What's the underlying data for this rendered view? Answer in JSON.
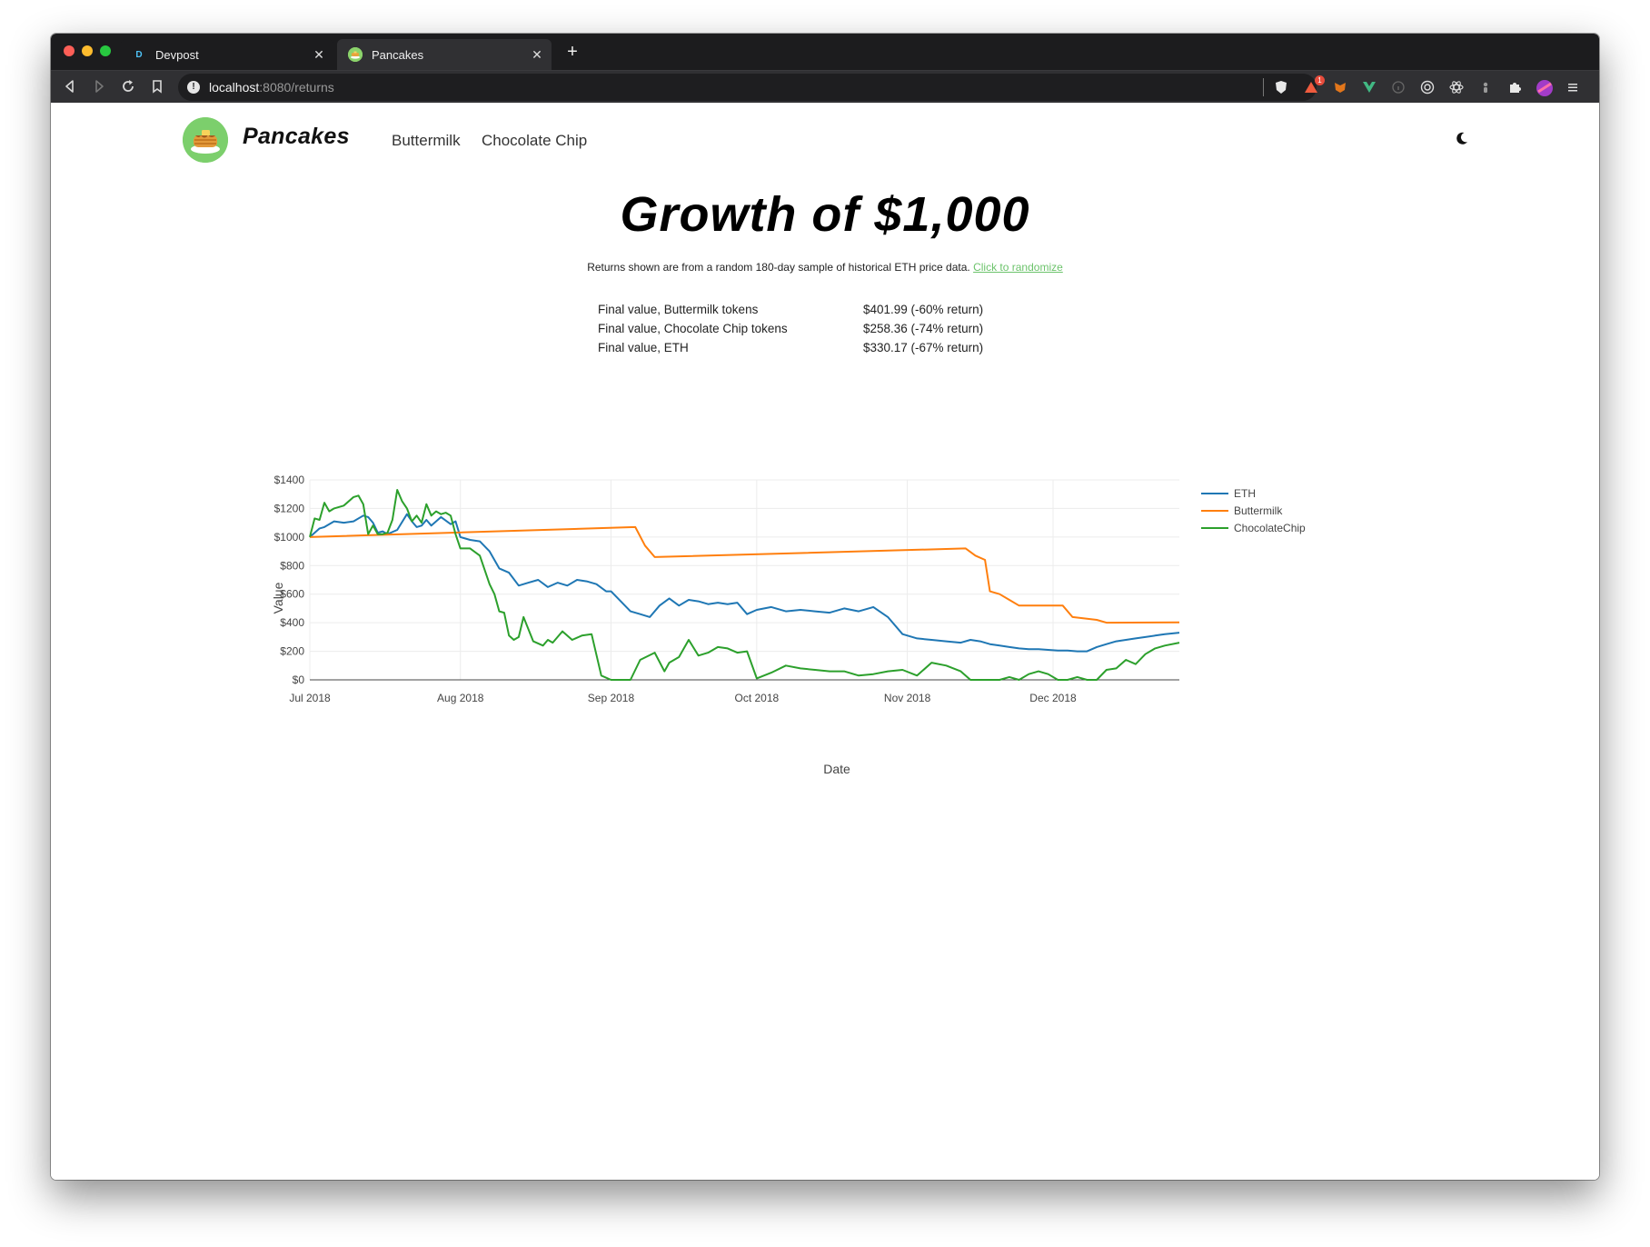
{
  "browser": {
    "tabs": [
      {
        "title": "Devpost",
        "favicon": "D",
        "active": false
      },
      {
        "title": "Pancakes",
        "favicon": "",
        "active": true
      }
    ],
    "url": {
      "host": "localhost",
      "path": ":8080/returns"
    },
    "close_symbol": "✕",
    "new_tab_symbol": "+",
    "extension_badge": "1"
  },
  "nav": {
    "brand": "Pancakes",
    "links": [
      "Buttermilk",
      "Chocolate Chip"
    ]
  },
  "page": {
    "heading": "Growth of $1,000",
    "subtitle": "Returns shown are from a random 180-day sample of historical ETH price data.",
    "randomize_link": "Click to randomize"
  },
  "results": [
    {
      "label": "Final value, Buttermilk tokens",
      "value": "$401.99 (-60% return)"
    },
    {
      "label": "Final value, Chocolate Chip tokens",
      "value": "$258.36 (-74% return)"
    },
    {
      "label": "Final value, ETH",
      "value": "$330.17 (-67% return)"
    }
  ],
  "colors": {
    "eth": "#1f77b4",
    "buttermilk": "#ff7f0e",
    "chocolatechip": "#2ca02c",
    "link": "#6cc36b"
  },
  "chart_data": {
    "type": "line",
    "xlabel": "Date",
    "ylabel": "Value",
    "x_range": [
      "2018-07-01",
      "2018-12-27"
    ],
    "ylim": [
      0,
      1400
    ],
    "y_ticks": [
      0,
      200,
      400,
      600,
      800,
      1000,
      1200,
      1400
    ],
    "y_tick_labels": [
      "$0",
      "$200",
      "$400",
      "$600",
      "$800",
      "$1000",
      "$1200",
      "$1400"
    ],
    "x_ticks": [
      "2018-07-01",
      "2018-08-01",
      "2018-09-01",
      "2018-10-01",
      "2018-11-01",
      "2018-12-01"
    ],
    "x_tick_labels": [
      "Jul 2018",
      "Aug 2018",
      "Sep 2018",
      "Oct 2018",
      "Nov 2018",
      "Dec 2018"
    ],
    "grid": true,
    "legend": "top-right",
    "series": [
      {
        "name": "ETH",
        "x": [
          "2018-07-01",
          "2018-07-03",
          "2018-07-04",
          "2018-07-06",
          "2018-07-08",
          "2018-07-10",
          "2018-07-12",
          "2018-07-13",
          "2018-07-14",
          "2018-07-15",
          "2018-07-16",
          "2018-07-17",
          "2018-07-19",
          "2018-07-21",
          "2018-07-22",
          "2018-07-23",
          "2018-07-24",
          "2018-07-25",
          "2018-07-26",
          "2018-07-28",
          "2018-07-30",
          "2018-07-31",
          "2018-08-01",
          "2018-08-03",
          "2018-08-05",
          "2018-08-07",
          "2018-08-09",
          "2018-08-11",
          "2018-08-13",
          "2018-08-15",
          "2018-08-17",
          "2018-08-19",
          "2018-08-21",
          "2018-08-23",
          "2018-08-25",
          "2018-08-27",
          "2018-08-29",
          "2018-08-31",
          "2018-09-01",
          "2018-09-03",
          "2018-09-05",
          "2018-09-07",
          "2018-09-09",
          "2018-09-11",
          "2018-09-13",
          "2018-09-15",
          "2018-09-17",
          "2018-09-19",
          "2018-09-21",
          "2018-09-23",
          "2018-09-25",
          "2018-09-27",
          "2018-09-29",
          "2018-10-01",
          "2018-10-04",
          "2018-10-07",
          "2018-10-10",
          "2018-10-13",
          "2018-10-16",
          "2018-10-19",
          "2018-10-22",
          "2018-10-25",
          "2018-10-28",
          "2018-10-31",
          "2018-11-03",
          "2018-11-06",
          "2018-11-09",
          "2018-11-12",
          "2018-11-14",
          "2018-11-16",
          "2018-11-18",
          "2018-11-20",
          "2018-11-22",
          "2018-11-24",
          "2018-11-26",
          "2018-11-28",
          "2018-11-30",
          "2018-12-02",
          "2018-12-04",
          "2018-12-06",
          "2018-12-08",
          "2018-12-10",
          "2018-12-12",
          "2018-12-14",
          "2018-12-16",
          "2018-12-18",
          "2018-12-20",
          "2018-12-22",
          "2018-12-24",
          "2018-12-27"
        ],
        "values": [
          1000,
          1060,
          1070,
          1110,
          1100,
          1110,
          1150,
          1140,
          1100,
          1030,
          1040,
          1020,
          1050,
          1160,
          1110,
          1070,
          1080,
          1120,
          1080,
          1140,
          1090,
          1110,
          1000,
          980,
          970,
          900,
          780,
          750,
          660,
          680,
          700,
          650,
          680,
          660,
          700,
          690,
          670,
          620,
          620,
          550,
          480,
          460,
          440,
          520,
          570,
          520,
          560,
          550,
          530,
          540,
          530,
          540,
          460,
          490,
          510,
          480,
          490,
          480,
          470,
          500,
          480,
          510,
          440,
          320,
          290,
          280,
          270,
          260,
          280,
          270,
          250,
          240,
          230,
          220,
          215,
          215,
          210,
          205,
          205,
          200,
          200,
          230,
          250,
          270,
          280,
          290,
          300,
          310,
          320,
          330
        ]
      },
      {
        "name": "Buttermilk",
        "x": [
          "2018-07-01",
          "2018-09-06",
          "2018-09-08",
          "2018-09-10",
          "2018-11-13",
          "2018-11-15",
          "2018-11-17",
          "2018-11-18",
          "2018-11-20",
          "2018-11-22",
          "2018-11-24",
          "2018-11-28",
          "2018-12-03",
          "2018-12-05",
          "2018-12-10",
          "2018-12-12",
          "2018-12-27"
        ],
        "values": [
          1000,
          1070,
          940,
          860,
          920,
          870,
          840,
          620,
          600,
          560,
          520,
          520,
          520,
          440,
          420,
          400,
          402
        ]
      },
      {
        "name": "ChocolateChip",
        "x": [
          "2018-07-01",
          "2018-07-02",
          "2018-07-03",
          "2018-07-04",
          "2018-07-05",
          "2018-07-06",
          "2018-07-08",
          "2018-07-10",
          "2018-07-11",
          "2018-07-12",
          "2018-07-13",
          "2018-07-14",
          "2018-07-15",
          "2018-07-16",
          "2018-07-17",
          "2018-07-18",
          "2018-07-19",
          "2018-07-20",
          "2018-07-21",
          "2018-07-22",
          "2018-07-23",
          "2018-07-24",
          "2018-07-25",
          "2018-07-26",
          "2018-07-27",
          "2018-07-28",
          "2018-07-29",
          "2018-07-30",
          "2018-07-31",
          "2018-08-01",
          "2018-08-03",
          "2018-08-05",
          "2018-08-07",
          "2018-08-08",
          "2018-08-09",
          "2018-08-10",
          "2018-08-11",
          "2018-08-12",
          "2018-08-13",
          "2018-08-14",
          "2018-08-16",
          "2018-08-18",
          "2018-08-19",
          "2018-08-20",
          "2018-08-22",
          "2018-08-24",
          "2018-08-26",
          "2018-08-28",
          "2018-08-30",
          "2018-09-01",
          "2018-09-03",
          "2018-09-05",
          "2018-09-07",
          "2018-09-10",
          "2018-09-12",
          "2018-09-13",
          "2018-09-15",
          "2018-09-17",
          "2018-09-19",
          "2018-09-21",
          "2018-09-23",
          "2018-09-25",
          "2018-09-27",
          "2018-09-29",
          "2018-10-01",
          "2018-10-04",
          "2018-10-07",
          "2018-10-10",
          "2018-10-13",
          "2018-10-16",
          "2018-10-19",
          "2018-10-22",
          "2018-10-25",
          "2018-10-28",
          "2018-10-31",
          "2018-11-03",
          "2018-11-06",
          "2018-11-09",
          "2018-11-12",
          "2018-11-14",
          "2018-11-16",
          "2018-11-18",
          "2018-11-20",
          "2018-11-22",
          "2018-11-24",
          "2018-11-26",
          "2018-11-28",
          "2018-11-30",
          "2018-12-02",
          "2018-12-04",
          "2018-12-06",
          "2018-12-08",
          "2018-12-10",
          "2018-12-12",
          "2018-12-14",
          "2018-12-16",
          "2018-12-18",
          "2018-12-20",
          "2018-12-22",
          "2018-12-24",
          "2018-12-27"
        ],
        "values": [
          1000,
          1130,
          1120,
          1240,
          1180,
          1200,
          1220,
          1280,
          1290,
          1230,
          1020,
          1080,
          1020,
          1020,
          1030,
          1120,
          1330,
          1250,
          1200,
          1110,
          1150,
          1100,
          1230,
          1150,
          1180,
          1160,
          1170,
          1150,
          1020,
          920,
          920,
          870,
          670,
          600,
          480,
          470,
          310,
          280,
          300,
          440,
          270,
          240,
          280,
          260,
          340,
          280,
          310,
          320,
          30,
          0,
          0,
          0,
          140,
          190,
          60,
          120,
          160,
          280,
          170,
          190,
          230,
          220,
          190,
          200,
          10,
          50,
          100,
          80,
          70,
          60,
          60,
          30,
          40,
          60,
          70,
          30,
          120,
          100,
          60,
          0,
          0,
          0,
          0,
          20,
          0,
          40,
          60,
          40,
          0,
          0,
          20,
          0,
          0,
          70,
          80,
          140,
          110,
          180,
          220,
          240,
          260
        ]
      }
    ]
  }
}
